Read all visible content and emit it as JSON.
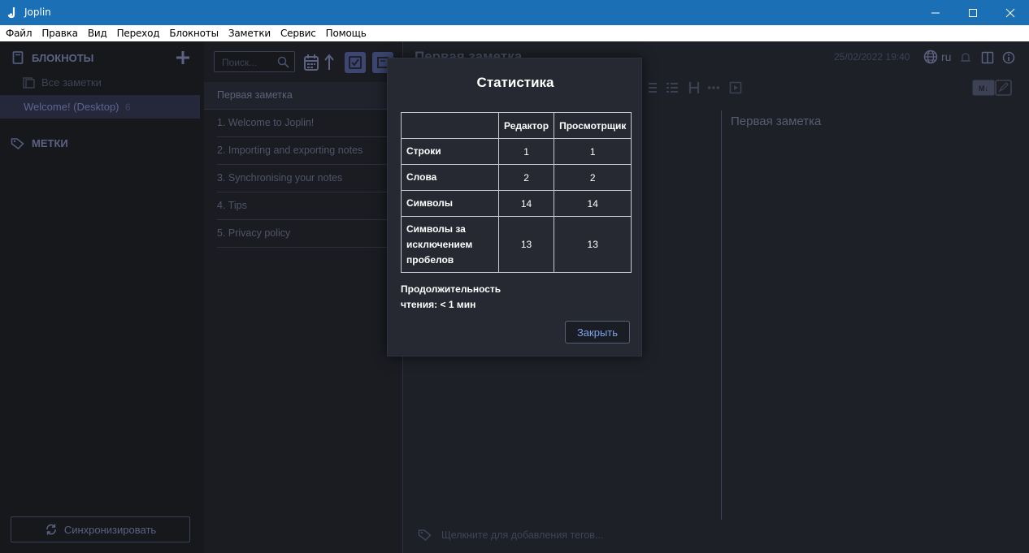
{
  "window": {
    "title": "Joplin"
  },
  "menu": [
    "Файл",
    "Правка",
    "Вид",
    "Переход",
    "Блокноты",
    "Заметки",
    "Сервис",
    "Помощь"
  ],
  "sidebar": {
    "notebooks_label": "БЛОКНОТЫ",
    "all_notes_label": "Все заметки",
    "notebook": {
      "label": "Welcome! (Desktop)",
      "count": "6"
    },
    "tags_label": "МЕТКИ",
    "sync_label": "Синхронизировать"
  },
  "notelist": {
    "search_placeholder": "Поиск...",
    "notes": [
      "Первая заметка",
      "1. Welcome to Joplin!",
      "2. Importing and exporting notes",
      "3. Synchronising your notes",
      "4. Tips",
      "5. Privacy policy"
    ]
  },
  "editor": {
    "title": "Первая заметка",
    "date": "25/02/2022 19:40",
    "lang": "ru",
    "viewer_text": "Первая заметка",
    "tag_placeholder": "Щелкните для добавления тегов..."
  },
  "modal": {
    "title": "Статистика",
    "col_editor": "Редактор",
    "col_viewer": "Просмотрщик",
    "rows": [
      {
        "label": "Строки",
        "editor": "1",
        "viewer": "1"
      },
      {
        "label": "Слова",
        "editor": "2",
        "viewer": "2"
      },
      {
        "label": "Символы",
        "editor": "14",
        "viewer": "14"
      },
      {
        "label_l1": "Символы за",
        "label_l2": "исключением",
        "label_l3": "пробелов",
        "editor": "13",
        "viewer": "13"
      }
    ],
    "reading_l1": "Продолжительность",
    "reading_l2": "чтения: < 1 мин",
    "close_label": "Закрыть"
  },
  "colors": {
    "titlebar": "#1a6fb5",
    "accent": "#7aa3e8"
  }
}
